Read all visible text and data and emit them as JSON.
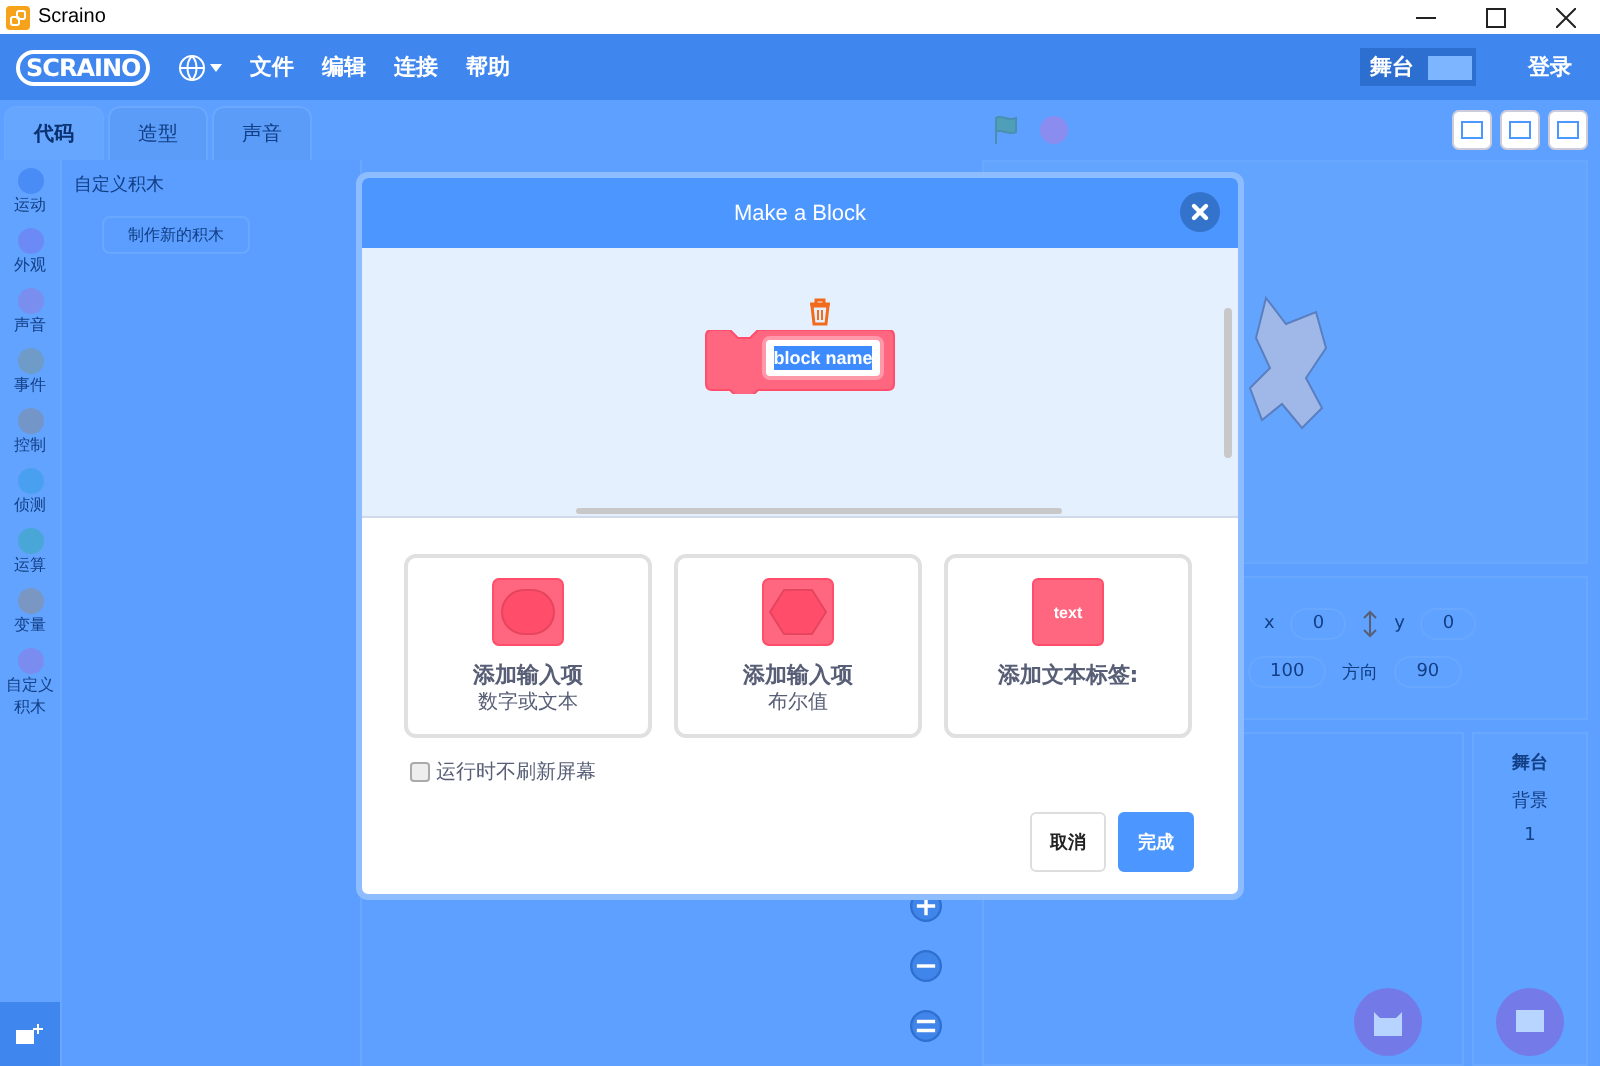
{
  "window": {
    "title": "Scraino"
  },
  "menu_bar": {
    "logo": "SCRAINO",
    "items": [
      "文件",
      "编辑",
      "连接",
      "帮助"
    ],
    "stage_toggle": "舞台",
    "login": "登录"
  },
  "editor_tabs": [
    {
      "label": "代码",
      "selected": true
    },
    {
      "label": "造型",
      "selected": false
    },
    {
      "label": "声音",
      "selected": false
    }
  ],
  "categories": [
    {
      "label": "运动",
      "color": "#4a8cf5"
    },
    {
      "label": "外观",
      "color": "#6b8af5"
    },
    {
      "label": "声音",
      "color": "#7a8ef0"
    },
    {
      "label": "事件",
      "color": "#6e9bc8"
    },
    {
      "label": "控制",
      "color": "#7495c8"
    },
    {
      "label": "侦测",
      "color": "#4aa0f0"
    },
    {
      "label": "运算",
      "color": "#48a7d6"
    },
    {
      "label": "变量",
      "color": "#7a97c4"
    },
    {
      "label": "自定义积木",
      "color": "#7a8cf0"
    }
  ],
  "palette": {
    "heading": "自定义积木",
    "make_block_button": "制作新的积木"
  },
  "sprite_info": {
    "x_label": "x",
    "x_value": "0",
    "y_label": "y",
    "y_value": "0",
    "size_value": "100",
    "direction_label": "方向",
    "direction_value": "90"
  },
  "stage_pane": {
    "title": "舞台",
    "backdrops_label": "背景",
    "backdrop_count": "1"
  },
  "modal": {
    "title": "Make a Block",
    "block_name": "block name",
    "options": [
      {
        "kind": "number_text",
        "title": "添加输入项",
        "subtitle": "数字或文本"
      },
      {
        "kind": "boolean",
        "title": "添加输入项",
        "subtitle": "布尔值"
      },
      {
        "kind": "label",
        "icon_text": "text",
        "title": "添加文本标签:"
      }
    ],
    "run_without_refresh": {
      "label": "运行时不刷新屏幕",
      "checked": false
    },
    "buttons": {
      "cancel": "取消",
      "ok": "完成"
    }
  }
}
